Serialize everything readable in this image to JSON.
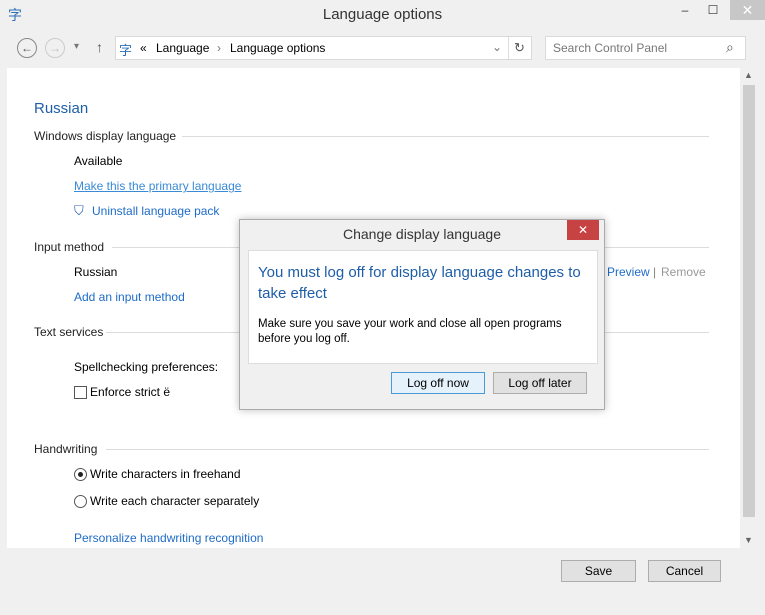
{
  "window": {
    "title": "Language options",
    "minimize": "–",
    "maximize": "☐",
    "close": "✕"
  },
  "nav": {
    "back": "←",
    "forward": "→",
    "recent": "▾",
    "up": "↑",
    "breadcrumb_prefix": "«",
    "breadcrumb": [
      "Language",
      "Language options"
    ],
    "separator": "›",
    "dropdown": "⌄",
    "refresh": "↻",
    "search_placeholder": "Search Control Panel",
    "search_icon": "⌕"
  },
  "content": {
    "language": "Russian",
    "display_section": "Windows display language",
    "status": "Available",
    "make_primary": "Make this the primary language",
    "uninstall": "Uninstall language pack",
    "input_section": "Input method",
    "input_name": "Russian",
    "preview": "Preview",
    "remove": "Remove",
    "add_input": "Add an input method",
    "text_section": "Text services",
    "spell_label": "Spellchecking preferences:",
    "enforce": "Enforce strict ё",
    "enforce_checked": false,
    "hand_section": "Handwriting",
    "radio1": "Write characters in freehand",
    "radio2": "Write each character separately",
    "selected_radio": 1,
    "personalize": "Personalize handwriting recognition"
  },
  "footer": {
    "save": "Save",
    "cancel": "Cancel"
  },
  "dialog": {
    "title": "Change display language",
    "close": "✕",
    "heading": "You must log off for display language changes to take effect",
    "body": "Make sure you save your work and close all open programs before you log off.",
    "log_off_now": "Log off now",
    "log_off_later": "Log off later"
  }
}
